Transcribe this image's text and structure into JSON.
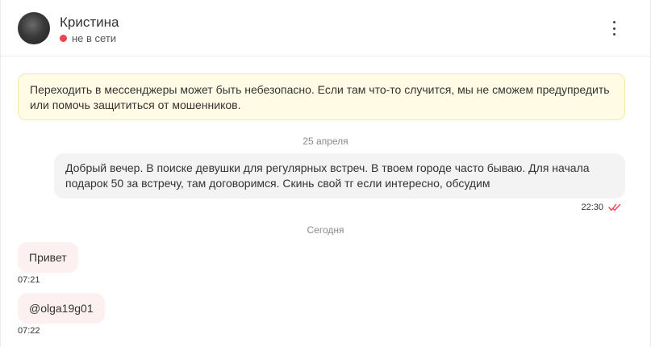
{
  "header": {
    "contact_name": "Кристина",
    "status_text": "не в сети",
    "status_color": "#f0424f"
  },
  "warning": {
    "text": "Переходить в мессенджеры может быть небезопасно. Если там что-то случится, мы не сможем предупредить или помочь защититься от мошенников."
  },
  "messages": {
    "date_1": "25 апреля",
    "out_1": {
      "text": "Добрый вечер. В поиске девушки для регулярных встреч. В твоем городе часто бываю. Для начала подарок 50 за встречу, там договоримся. Скинь свой тг если интересно, обсудим",
      "time": "22:30",
      "status_icon": "double-check-icon"
    },
    "date_2": "Сегодня",
    "in_1": {
      "text": "Привет",
      "time": "07:21"
    },
    "in_2": {
      "text": "@olga19g01",
      "time": "07:22"
    }
  },
  "colors": {
    "accent_red": "#f0424f",
    "warning_bg": "#fffbe4",
    "incoming_bg": "#fdf0f0",
    "outgoing_bg": "#f3f3f4"
  }
}
